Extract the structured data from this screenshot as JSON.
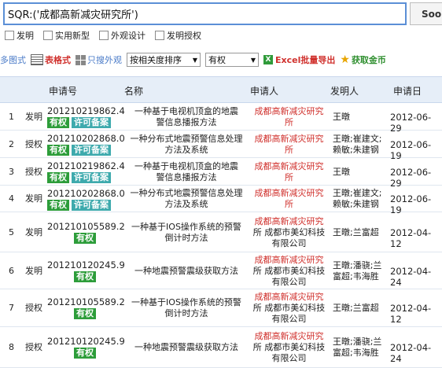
{
  "search": {
    "query": "SQR:('成都高新减灾研究所')",
    "button_label": "Sool"
  },
  "filters": [
    "发明",
    "实用新型",
    "外观设计",
    "发明授权"
  ],
  "toolbar": {
    "multi_view": "多图式",
    "table_view": "表格式",
    "search_only": "只搜外观",
    "sort_select": "按相关度排序",
    "status_select": "有权",
    "excel_export": "Excel批量导出",
    "get_coins": "获取金币"
  },
  "table": {
    "headers": [
      "申请号",
      "名称",
      "申请人",
      "发明人",
      "申请日"
    ],
    "rows": [
      {
        "num": "1",
        "type": "发明",
        "app_no": "201210219862.4",
        "badges": [
          "有权",
          "许可备案"
        ],
        "title": [
          "一种基于电视机顶盒的地震",
          "警信息播报方法"
        ],
        "applicant": [
          "成都高新减灾研究",
          "所"
        ],
        "applicant_red": [
          true,
          true
        ],
        "inventor": [
          "王暾"
        ],
        "date": "2012-06-29"
      },
      {
        "num": "2",
        "type": "授权",
        "app_no": "201210202868.0",
        "badges": [
          "有权",
          "许可备案"
        ],
        "title": [
          "一种分布式地震预警信息处理",
          "方法及系统"
        ],
        "applicant": [
          "成都高新减灾研究",
          "所"
        ],
        "applicant_red": [
          true,
          true
        ],
        "inventor": [
          "王暾;崔建文;",
          "赖敏;朱建钢"
        ],
        "date": "2012-06-19"
      },
      {
        "num": "3",
        "type": "授权",
        "app_no": "201210219862.4",
        "badges": [
          "有权",
          "许可备案"
        ],
        "title": [
          "一种基于电视机顶盒的地震",
          "警信息播报方法"
        ],
        "applicant": [
          "成都高新减灾研究",
          "所"
        ],
        "applicant_red": [
          true,
          true
        ],
        "inventor": [
          "王暾"
        ],
        "date": "2012-06-29"
      },
      {
        "num": "4",
        "type": "发明",
        "app_no": "201210202868.0",
        "badges": [
          "有权",
          "许可备案"
        ],
        "title": [
          "一种分布式地震预警信息处理",
          "方法及系统"
        ],
        "applicant": [
          "成都高新减灾研究",
          "所"
        ],
        "applicant_red": [
          true,
          true
        ],
        "inventor": [
          "王暾;崔建文;",
          "赖敏;朱建钢"
        ],
        "date": "2012-06-19"
      },
      {
        "num": "5",
        "type": "发明",
        "app_no": "201210105589.2",
        "badges": [
          "有权"
        ],
        "title": [
          "一种基于IOS操作系统的预警",
          "倒计时方法"
        ],
        "applicant": [
          "成都高新减灾研究",
          "所 成都市美幻科技",
          "有限公司"
        ],
        "applicant_red": [
          true,
          false,
          false
        ],
        "inventor": [
          "王暾;兰富超"
        ],
        "date": "2012-04-12"
      },
      {
        "num": "6",
        "type": "发明",
        "app_no": "201210120245.9",
        "badges": [
          "有权"
        ],
        "title": [
          "一种地震预警震级获取方法"
        ],
        "applicant": [
          "成都高新减灾研究",
          "所 成都市美幻科技",
          "有限公司"
        ],
        "applicant_red": [
          true,
          false,
          false
        ],
        "inventor": [
          "王暾;潘骁;兰",
          "富超;韦海胜"
        ],
        "date": "2012-04-24"
      },
      {
        "num": "7",
        "type": "授权",
        "app_no": "201210105589.2",
        "badges": [
          "有权"
        ],
        "title": [
          "一种基于IOS操作系统的预警",
          "倒计时方法"
        ],
        "applicant": [
          "成都高新减灾研究",
          "所 成都市美幻科技",
          "有限公司"
        ],
        "applicant_red": [
          true,
          false,
          false
        ],
        "inventor": [
          "王暾;兰富超"
        ],
        "date": "2012-04-12"
      },
      {
        "num": "8",
        "type": "授权",
        "app_no": "201210120245.9",
        "badges": [
          "有权"
        ],
        "title": [
          "一种地震预警震级获取方法"
        ],
        "applicant": [
          "成都高新减灾研究",
          "所 成都市美幻科技",
          "有限公司"
        ],
        "applicant_red": [
          true,
          false,
          false
        ],
        "inventor": [
          "王暾;潘骁;兰",
          "富超;韦海胜"
        ],
        "date": "2012-04-24"
      }
    ]
  },
  "colors": {
    "accent_blue": "#5b8fd6",
    "header_bg": "#e6eef8",
    "badge_green": "#2d9d3a",
    "badge_teal": "#3eaaad",
    "applicant_red": "#d0312d"
  }
}
